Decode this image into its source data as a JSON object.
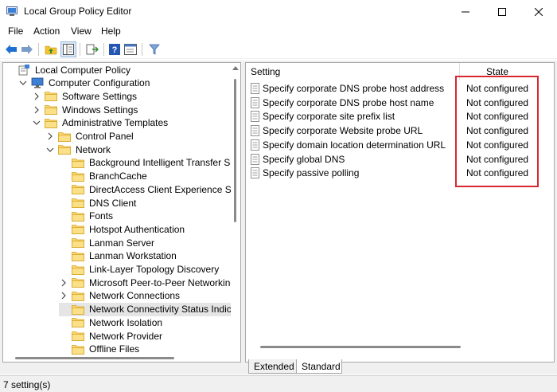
{
  "window": {
    "title": "Local Group Policy Editor",
    "icon": "group-policy-app-icon",
    "controls": [
      "minimize",
      "maximize",
      "close"
    ]
  },
  "menu": {
    "items": [
      "File",
      "Action",
      "View",
      "Help"
    ]
  },
  "toolbar": {
    "buttons": [
      "back-arrow-icon",
      "forward-arrow-icon",
      "up-folder-icon",
      "show-hide-tree-icon",
      "export-list-icon",
      "help-icon",
      "properties-icon",
      "filter-icon"
    ]
  },
  "tree": {
    "items": [
      {
        "label": "Local Computer Policy",
        "level": 0,
        "expander": "none",
        "icon": "computer-policy-icon"
      },
      {
        "label": "Computer Configuration",
        "level": 1,
        "expander": "expanded",
        "icon": "computer-icon"
      },
      {
        "label": "Software Settings",
        "level": 2,
        "expander": "collapsed",
        "icon": "folder-icon"
      },
      {
        "label": "Windows Settings",
        "level": 2,
        "expander": "collapsed",
        "icon": "folder-icon"
      },
      {
        "label": "Administrative Templates",
        "level": 2,
        "expander": "expanded",
        "icon": "folder-icon"
      },
      {
        "label": "Control Panel",
        "level": 3,
        "expander": "collapsed",
        "icon": "folder-icon"
      },
      {
        "label": "Network",
        "level": 3,
        "expander": "expanded",
        "icon": "folder-icon"
      },
      {
        "label": "Background Intelligent Transfer Service",
        "level": 4,
        "expander": "none",
        "icon": "folder-icon"
      },
      {
        "label": "BranchCache",
        "level": 4,
        "expander": "none",
        "icon": "folder-icon"
      },
      {
        "label": "DirectAccess Client Experience Settings",
        "level": 4,
        "expander": "none",
        "icon": "folder-icon"
      },
      {
        "label": "DNS Client",
        "level": 4,
        "expander": "none",
        "icon": "folder-icon"
      },
      {
        "label": "Fonts",
        "level": 4,
        "expander": "none",
        "icon": "folder-icon"
      },
      {
        "label": "Hotspot Authentication",
        "level": 4,
        "expander": "none",
        "icon": "folder-icon"
      },
      {
        "label": "Lanman Server",
        "level": 4,
        "expander": "none",
        "icon": "folder-icon"
      },
      {
        "label": "Lanman Workstation",
        "level": 4,
        "expander": "none",
        "icon": "folder-icon"
      },
      {
        "label": "Link-Layer Topology Discovery",
        "level": 4,
        "expander": "none",
        "icon": "folder-icon"
      },
      {
        "label": "Microsoft Peer-to-Peer Networking Ser",
        "level": 4,
        "expander": "collapsed",
        "icon": "folder-icon"
      },
      {
        "label": "Network Connections",
        "level": 4,
        "expander": "collapsed",
        "icon": "folder-icon"
      },
      {
        "label": "Network Connectivity Status Indicator",
        "level": 4,
        "expander": "none",
        "icon": "folder-icon",
        "selected": true
      },
      {
        "label": "Network Isolation",
        "level": 4,
        "expander": "none",
        "icon": "folder-icon"
      },
      {
        "label": "Network Provider",
        "level": 4,
        "expander": "none",
        "icon": "folder-icon"
      },
      {
        "label": "Offline Files",
        "level": 4,
        "expander": "none",
        "icon": "folder-icon"
      }
    ]
  },
  "list": {
    "columns": {
      "setting": "Setting",
      "state": "State"
    },
    "rows": [
      {
        "name": "Specify corporate DNS probe host address",
        "state": "Not configured"
      },
      {
        "name": "Specify corporate DNS probe host name",
        "state": "Not configured"
      },
      {
        "name": "Specify corporate site prefix list",
        "state": "Not configured"
      },
      {
        "name": "Specify corporate Website probe URL",
        "state": "Not configured"
      },
      {
        "name": "Specify domain location determination URL",
        "state": "Not configured"
      },
      {
        "name": "Specify global DNS",
        "state": "Not configured"
      },
      {
        "name": "Specify passive polling",
        "state": "Not configured"
      }
    ],
    "highlight_color": "#d7282f"
  },
  "tabs": {
    "items": [
      "Extended",
      "Standard"
    ],
    "active": "Standard"
  },
  "status": {
    "text": "7 setting(s)"
  },
  "colors": {
    "folder": "#f4c430",
    "accent_arrow": "#1e6fd0",
    "selection": "#e5e5e5"
  }
}
